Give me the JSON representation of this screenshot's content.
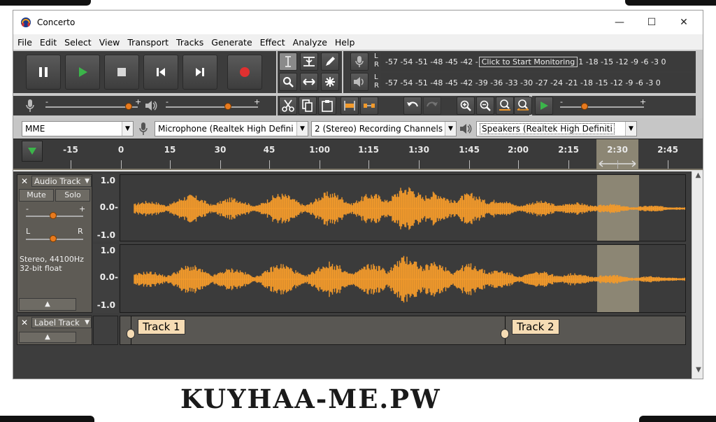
{
  "window": {
    "title": "Concerto",
    "controls": [
      "—",
      "☐",
      "✕"
    ]
  },
  "menu": [
    "File",
    "Edit",
    "Select",
    "View",
    "Transport",
    "Tracks",
    "Generate",
    "Effect",
    "Analyze",
    "Help"
  ],
  "meters": {
    "record_scale": "-57 -54 -51 -48 -45 -42 -",
    "record_hint": "Click to Start Monitoring",
    "record_scale_tail": "1 -18 -15 -12 -9 -6 -3 0",
    "play_scale": "-57 -54 -51 -48 -45 -42 -39 -36 -33 -30 -27 -24 -21 -18 -15 -12 -9 -6 -3 0",
    "l": "L",
    "r": "R"
  },
  "mixer": {
    "plus": "+",
    "minus": "-"
  },
  "device": {
    "host": "MME",
    "mic": "Microphone (Realtek High Defini",
    "channels": "2 (Stereo) Recording Channels",
    "speakers": "Speakers (Realtek High Definiti"
  },
  "timeline": {
    "ticks": [
      "-15",
      "0",
      "15",
      "30",
      "45",
      "1:00",
      "1:15",
      "1:30",
      "1:45",
      "2:00",
      "2:15",
      "2:30",
      "2:45"
    ]
  },
  "audio_track": {
    "name": "Audio Track",
    "mute": "Mute",
    "solo": "Solo",
    "gain_minus": "-",
    "gain_plus": "+",
    "pan_l": "L",
    "pan_r": "R",
    "info1": "Stereo, 44100Hz",
    "info2": "32-bit float",
    "scale": [
      "1.0",
      "0.0-",
      "-1.0"
    ]
  },
  "label_track": {
    "name": "Label Track",
    "labels": [
      "Track 1",
      "Track 2"
    ]
  },
  "watermark": "KUYHAA-ME.PW",
  "colors": {
    "wave": "#f39a2b",
    "selection": "#8c8674",
    "panel": "#5e5b55",
    "record": "#e03030",
    "play": "#3bb54a"
  }
}
